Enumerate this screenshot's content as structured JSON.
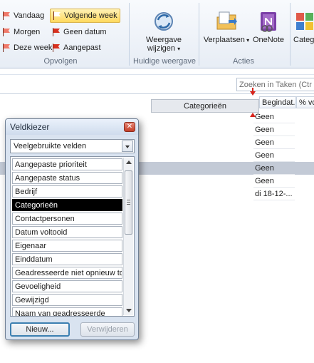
{
  "ribbon": {
    "followup": {
      "items": [
        {
          "label": "Vandaag",
          "selected": false
        },
        {
          "label": "Volgende week",
          "selected": true
        },
        {
          "label": "Morgen",
          "selected": false
        },
        {
          "label": "Geen datum",
          "selected": false
        },
        {
          "label": "Deze week",
          "selected": false
        },
        {
          "label": "Aangepast",
          "selected": false
        }
      ],
      "group_label": "Opvolgen"
    },
    "current_view": {
      "button_label_line1": "Weergave",
      "button_label_line2": "wijzigen",
      "group_label": "Huidige weergave"
    },
    "actions": {
      "move_label": "Verplaatsen",
      "onenote_label": "OneNote",
      "group_label": "Acties"
    },
    "categorize_label": "Categ"
  },
  "search": {
    "placeholder": "Zoeken in Taken (Ctr"
  },
  "columns": {
    "dragging": "Categorieën",
    "begindatum": "Begindat...",
    "percent": "% vo"
  },
  "rows": [
    "Geen",
    "Geen",
    "Geen",
    "Geen",
    "Geen",
    "Geen",
    "di 18-12-..."
  ],
  "selected_row": 4,
  "field_chooser": {
    "title": "Veldkiezer",
    "close": "✕",
    "category": "Veelgebruikte velden",
    "fields": [
      "Aangepaste prioriteit",
      "Aangepaste status",
      "Bedrijf",
      "Categorieën",
      "Contactpersonen",
      "Datum voltooid",
      "Eigenaar",
      "Einddatum",
      "Geadresseerde niet opnieuw toe",
      "Gevoeligheid",
      "Gewijzigd",
      "Naam van geadresseerde"
    ],
    "selected_field": 3,
    "new_button": "Nieuw...",
    "delete_button": "Verwijderen"
  },
  "colors": {
    "accent": "#3c7fb1",
    "flag": "#d8311f",
    "selected_row": "#c3cad6"
  },
  "icons": {
    "flag": "flag-icon",
    "change_view": "change-view-icon",
    "move": "move-folder-icon",
    "onenote": "onenote-icon",
    "categorize": "categorize-icon",
    "close": "close-icon",
    "dropdown": "chevron-down-icon"
  }
}
